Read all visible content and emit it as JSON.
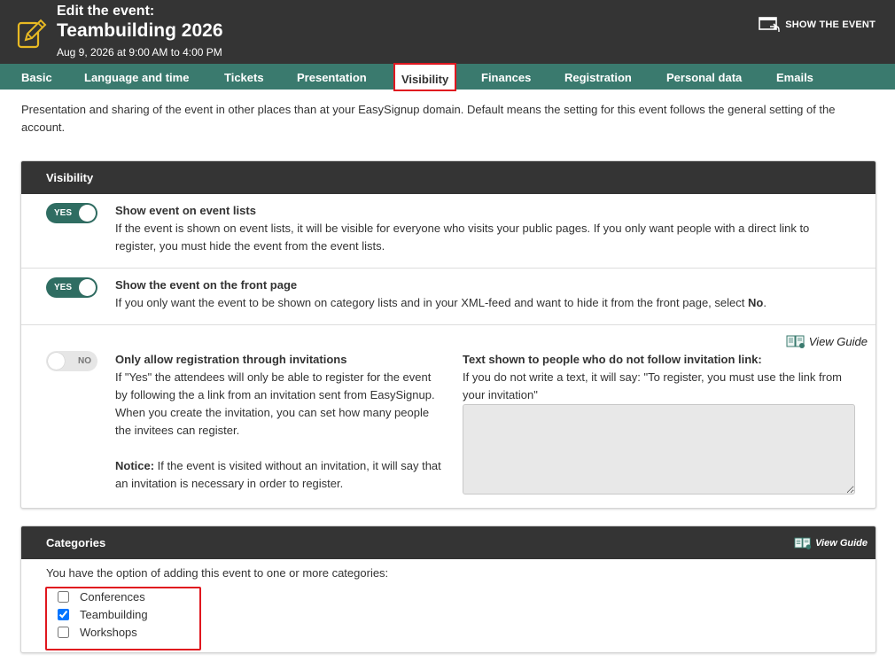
{
  "header": {
    "sup": "Edit the event:",
    "title": "Teambuilding 2026",
    "date": "Aug 9, 2026 at 9:00 AM to 4:00 PM",
    "show_event": "SHOW THE EVENT",
    "icon_edit": "edit-pencil-icon",
    "icon_show": "external-window-icon"
  },
  "tabs": [
    {
      "label": "Basic"
    },
    {
      "label": "Language and time"
    },
    {
      "label": "Tickets"
    },
    {
      "label": "Presentation"
    },
    {
      "label": "Visibility",
      "active": true
    },
    {
      "label": "Finances"
    },
    {
      "label": "Registration"
    },
    {
      "label": "Personal data"
    },
    {
      "label": "Emails"
    }
  ],
  "intro": "Presentation and sharing of the event in other places than at your EasySignup domain. Default means the setting for this event follows the general setting of the account.",
  "visibility": {
    "title": "Visibility",
    "list": {
      "toggle": "YES",
      "heading": "Show event on event lists",
      "text": "If the event is shown on event lists, it will be visible for everyone who visits your public pages. If you only want people with a direct link to register, you must hide the event from the event lists."
    },
    "front": {
      "toggle": "YES",
      "heading": "Show the event on the front page",
      "text_pre": "If you only want the event to be shown on category lists and in your XML-feed and want to hide it from the front page, select ",
      "text_bold": "No",
      "text_post": "."
    },
    "invite": {
      "guide": "View Guide",
      "toggle": "NO",
      "heading": "Only allow registration through invitations",
      "text": "If \"Yes\" the attendees will only be able to register for the event by following the a link from an invitation sent from EasySignup. When you create the invitation, you can set how many people the invitees can register.",
      "notice_label": "Notice:",
      "notice_text": " If the event is visited without an invitation, it will say that an invitation is necessary in order to register.",
      "link_heading": "Text shown to people who do not follow invitation link:",
      "link_text": "If you do not write a text, it will say: \"To register, you must use the link from your invitation\"",
      "textarea_value": ""
    }
  },
  "categories": {
    "title": "Categories",
    "guide": "View Guide",
    "intro": "You have the option of adding this event to one or more categories:",
    "items": [
      {
        "label": "Conferences",
        "checked": false
      },
      {
        "label": "Teambuilding",
        "checked": true
      },
      {
        "label": "Workshops",
        "checked": false
      }
    ]
  },
  "colors": {
    "header_bg": "#343434",
    "tabs_bg": "#3a7a6e",
    "toggle_on": "#2f6d62",
    "highlight": "#e0171f"
  }
}
